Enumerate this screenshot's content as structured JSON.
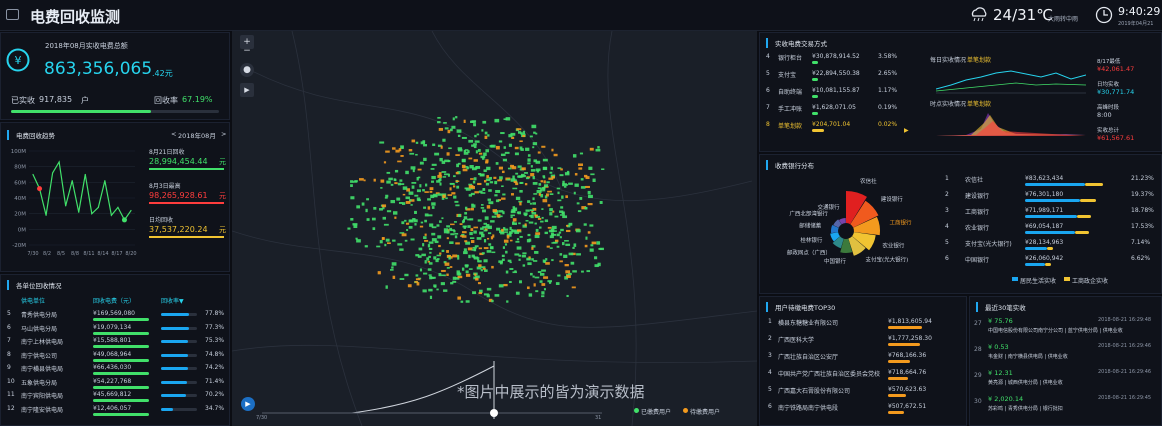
{
  "header": {
    "title": "电费回收监测",
    "temperature": "24/31℃",
    "condition": "大雨转中雨",
    "time": "9:40:29",
    "date": "2019年04月21"
  },
  "total": {
    "label": "2018年08月实收电费总额",
    "amount": "863,356,065",
    "amount_unit": ".42元",
    "paid_label": "已实收",
    "paid_value": "917,835",
    "paid_unit": "户",
    "rate_label": "回收率",
    "rate_value": "67.19%",
    "rate_fraction": 0.6719
  },
  "trend": {
    "title": "电费回收趋势",
    "month": "2018年08月",
    "prev": "<",
    "next": ">",
    "stats": [
      {
        "label": "8月21日回收",
        "value": "28,994,454.44",
        "unit": "元",
        "color": "#41e06a"
      },
      {
        "label": "8月3日最高",
        "value": "98,265,928.61",
        "unit": "元",
        "color": "#ff3d3d"
      },
      {
        "label": "日均回收",
        "value": "37,537,220.24",
        "unit": "元",
        "color": "#f1c432"
      }
    ]
  },
  "chart_data": {
    "type": "line",
    "title": "",
    "x": [
      "7/30",
      "8/2",
      "8/5",
      "8/8",
      "8/11",
      "8/14",
      "8/17",
      "8/20"
    ],
    "yticks": [
      "100M",
      "80M",
      "60M",
      "40M",
      "20M",
      "0M",
      "-20M"
    ],
    "ylim": [
      -20,
      100
    ],
    "values": [
      70,
      52,
      18,
      72,
      86,
      30,
      62,
      22,
      70,
      20,
      28,
      62,
      18,
      28,
      12,
      24
    ],
    "xtick_labels": [
      "7/30",
      "8/2",
      "8/5",
      "8/8",
      "8/11",
      "8/14",
      "8/17",
      "8/20"
    ]
  },
  "units": {
    "title": "各单位回收情况",
    "columns": [
      "供电单位",
      "回收电费（元）",
      "回收率▼"
    ],
    "rows": [
      {
        "rank": "5",
        "name": "青秀供电分局",
        "amount": "¥169,569,080",
        "pct": "77.8%",
        "p": 0.778
      },
      {
        "rank": "6",
        "name": "马山供电分局",
        "amount": "¥19,079,134",
        "pct": "77.3%",
        "p": 0.773
      },
      {
        "rank": "7",
        "name": "南宁上林供电局",
        "amount": "¥15,588,801",
        "pct": "75.3%",
        "p": 0.753
      },
      {
        "rank": "8",
        "name": "南宁供电公司",
        "amount": "¥49,068,964",
        "pct": "74.8%",
        "p": 0.748
      },
      {
        "rank": "9",
        "name": "南宁横县供电局",
        "amount": "¥66,436,030",
        "pct": "74.2%",
        "p": 0.742
      },
      {
        "rank": "10",
        "name": "五象供电分局",
        "amount": "¥54,227,768",
        "pct": "71.4%",
        "p": 0.714
      },
      {
        "rank": "11",
        "name": "南宁宾阳供电局",
        "amount": "¥45,669,812",
        "pct": "70.2%",
        "p": 0.702
      },
      {
        "rank": "12",
        "name": "南宁隆安供电局",
        "amount": "¥12,406,057",
        "pct": "34.7%",
        "p": 0.347
      }
    ]
  },
  "map": {
    "watermark": "*图片中展示的皆为演示数据",
    "legend": [
      {
        "label": "已缴费用户",
        "color": "#41e06a"
      },
      {
        "label": "待缴费用户",
        "color": "#f39a1e"
      }
    ],
    "timeline_start": "7/30",
    "timeline_end": "31",
    "play": "▶"
  },
  "pay_methods": {
    "title": "实收电费交易方式",
    "rows": [
      {
        "rank": "4",
        "name": "银行柜台",
        "amount": "¥30,878,914.52",
        "pct": "3.58%",
        "color": "#c9d1de"
      },
      {
        "rank": "5",
        "name": "支付宝",
        "amount": "¥22,894,550.38",
        "pct": "2.65%",
        "color": "#c9d1de"
      },
      {
        "rank": "6",
        "name": "自助终端",
        "amount": "¥10,081,155.87",
        "pct": "1.17%",
        "color": "#c9d1de"
      },
      {
        "rank": "7",
        "name": "手工冲账",
        "amount": "¥1,628,071.05",
        "pct": "0.19%",
        "color": "#c9d1de"
      },
      {
        "rank": "8",
        "name": "单笔划款",
        "amount": "¥204,701.04",
        "pct": "0.02%",
        "color": "#f1c432"
      }
    ]
  },
  "daily": {
    "title": "每日实收情况",
    "highlight": "单笔划款",
    "hourly_title": "时点实收情况",
    "highlight2": "单笔划款",
    "right": [
      {
        "label": "8/17最低",
        "value": "¥42,061.47",
        "color": "#ff3d3d"
      },
      {
        "label": "日均实收",
        "value": "¥30,771.74",
        "color": "#27d4ee"
      },
      {
        "label": "高峰时段",
        "value": "8:00",
        "color": "#c9d1de"
      },
      {
        "label": "实收总计",
        "value": "¥61,567.61",
        "color": "#ff3d3d"
      }
    ]
  },
  "banks": {
    "title": "收费银行分布",
    "labels": [
      "农信社",
      "建设银行",
      "工商银行",
      "农业银行",
      "支付宝(光大银行)",
      "中国银行",
      "邮政网点（广西）",
      "桂林银行",
      "邮储储蓄",
      "广西北部湾银行",
      "交通银行"
    ],
    "rows": [
      {
        "rank": "1",
        "name": "农信社",
        "amount": "¥83,623,434",
        "pct": "21.23%"
      },
      {
        "rank": "2",
        "name": "建设银行",
        "amount": "¥76,301,180",
        "pct": "19.37%"
      },
      {
        "rank": "3",
        "name": "工商银行",
        "amount": "¥71,989,171",
        "pct": "18.78%"
      },
      {
        "rank": "4",
        "name": "农业银行",
        "amount": "¥69,054,187",
        "pct": "17.53%"
      },
      {
        "rank": "5",
        "name": "支付宝(光大银行)",
        "amount": "¥28,134,963",
        "pct": "7.14%"
      },
      {
        "rank": "6",
        "name": "中国银行",
        "amount": "¥26,060,942",
        "pct": "6.62%"
      }
    ],
    "legend": [
      {
        "label": "居民生活实收",
        "color": "#1aa6f0"
      },
      {
        "label": "工商政企实收",
        "color": "#f1c432"
      }
    ]
  },
  "top30": {
    "title": "用户待缴电费TOP30",
    "rows": [
      {
        "rank": "1",
        "name": "横县东糖糖业有限公司",
        "amount": "¥1,813,605.94"
      },
      {
        "rank": "2",
        "name": "广西医科大学",
        "amount": "¥1,777,258.30"
      },
      {
        "rank": "3",
        "name": "广西壮族自治区公安厅",
        "amount": "¥768,166.36"
      },
      {
        "rank": "4",
        "name": "中国共产党广西壮族自治区委员会党校",
        "amount": "¥718,664.76"
      },
      {
        "rank": "5",
        "name": "广西嘉大石膏股份有限公司",
        "amount": "¥570,623.63"
      },
      {
        "rank": "6",
        "name": "南宁铁路局南宁供电段",
        "amount": "¥507,672.51"
      }
    ]
  },
  "recent": {
    "title": "最近30笔实收",
    "rows": [
      {
        "rank": "27",
        "amount": "¥ 75.76",
        "time": "2018-08-21 16:29:48",
        "desc": "中国电信股份有限公司南宁分公司 | 蓝宁供电分局 | 供电业收"
      },
      {
        "rank": "28",
        "amount": "¥ 0.53",
        "time": "2018-08-21 16:29:46",
        "desc": "韦金财 | 南宁横县供电局 | 供电业收"
      },
      {
        "rank": "29",
        "amount": "¥ 12.31",
        "time": "2018-08-21 16:29:46",
        "desc": "黄亮源 | 城西供电分局 | 供电业收"
      },
      {
        "rank": "30",
        "amount": "¥ 2,020.14",
        "time": "2018-08-21 16:29:45",
        "desc": "苏彩鸣 | 青秀供电分局 | 银行批扣"
      }
    ]
  }
}
